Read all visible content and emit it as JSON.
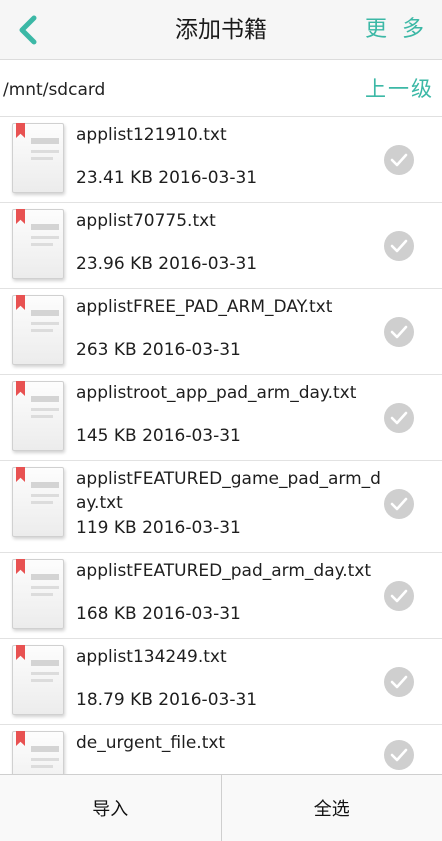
{
  "header": {
    "back_icon": "chevron-left-icon",
    "title": "添加书籍",
    "more_label": "更 多",
    "accent_color": "#3cb8a6"
  },
  "path": {
    "current": "/mnt/sdcard",
    "up_label": "上一级"
  },
  "files": [
    {
      "name": "applist121910.txt",
      "size": "23.41 KB",
      "date": "2016-03-31"
    },
    {
      "name": "applist70775.txt",
      "size": "23.96 KB",
      "date": "2016-03-31"
    },
    {
      "name": "applistFREE_PAD_ARM_DAY.txt",
      "size": "263 KB",
      "date": "2016-03-31"
    },
    {
      "name": "applistroot_app_pad_arm_day.txt",
      "size": "145 KB",
      "date": "2016-03-31"
    },
    {
      "name": "applistFEATURED_game_pad_arm_day.txt",
      "size": "119 KB",
      "date": "2016-03-31"
    },
    {
      "name": "applistFEATURED_pad_arm_day.txt",
      "size": "168 KB",
      "date": "2016-03-31"
    },
    {
      "name": "applist134249.txt",
      "size": "18.79 KB",
      "date": "2016-03-31"
    },
    {
      "name": "de_urgent_file.txt",
      "size": "",
      "date": ""
    }
  ],
  "bottom": {
    "import_label": "导入",
    "select_all_label": "全选"
  }
}
